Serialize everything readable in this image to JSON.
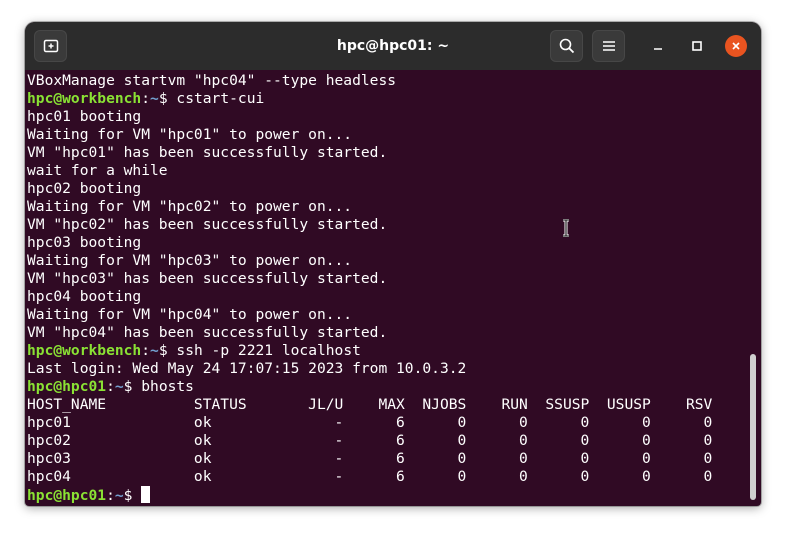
{
  "window": {
    "title": "hpc@hpc01: ~"
  },
  "header": {
    "new_tab_icon": "new-tab-icon",
    "search_icon": "search-icon",
    "menu_icon": "hamburger-menu-icon",
    "minimize_icon": "minimize-icon",
    "maximize_icon": "maximize-icon",
    "close_icon": "close-icon",
    "close_color": "#e95420"
  },
  "terminal": {
    "colors": {
      "background": "#300a24",
      "user": "#8ae234",
      "path": "#729fcf",
      "text": "#ffffff"
    },
    "lines": [
      {
        "text": "VBoxManage startvm \"hpc04\" --type headless"
      },
      {
        "prompt": {
          "user": "hpc@workbench",
          "sep": ":",
          "path": "~",
          "sym": "$ "
        },
        "text": "cstart-cui"
      },
      {
        "text": "hpc01 booting"
      },
      {
        "text": "Waiting for VM \"hpc01\" to power on..."
      },
      {
        "text": "VM \"hpc01\" has been successfully started."
      },
      {
        "text": "wait for a while"
      },
      {
        "text": "hpc02 booting"
      },
      {
        "text": "Waiting for VM \"hpc02\" to power on..."
      },
      {
        "text": "VM \"hpc02\" has been successfully started."
      },
      {
        "text": "hpc03 booting"
      },
      {
        "text": "Waiting for VM \"hpc03\" to power on..."
      },
      {
        "text": "VM \"hpc03\" has been successfully started."
      },
      {
        "text": "hpc04 booting"
      },
      {
        "text": "Waiting for VM \"hpc04\" to power on..."
      },
      {
        "text": "VM \"hpc04\" has been successfully started."
      },
      {
        "prompt": {
          "user": "hpc@workbench",
          "sep": ":",
          "path": "~",
          "sym": "$ "
        },
        "text": "ssh -p 2221 localhost"
      },
      {
        "text": "Last login: Wed May 24 17:07:15 2023 from 10.0.3.2"
      },
      {
        "prompt": {
          "user": "hpc@hpc01",
          "sep": ":",
          "path": "~",
          "sym": "$ "
        },
        "text": "bhosts"
      },
      {
        "text": "HOST_NAME          STATUS       JL/U    MAX  NJOBS    RUN  SSUSP  USUSP    RSV"
      },
      {
        "text": "hpc01              ok              -      6      0      0      0      0      0"
      },
      {
        "text": "hpc02              ok              -      6      0      0      0      0      0"
      },
      {
        "text": "hpc03              ok              -      6      0      0      0      0      0"
      },
      {
        "text": "hpc04              ok              -      6      0      0      0      0      0"
      },
      {
        "prompt": {
          "user": "hpc@hpc01",
          "sep": ":",
          "path": "~",
          "sym": "$ "
        },
        "text": "",
        "cursor": true
      }
    ]
  }
}
